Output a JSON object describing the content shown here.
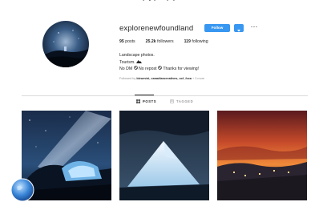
{
  "profile": {
    "username": "explorenewfoundland",
    "follow_label": "Follow",
    "more_label": "···"
  },
  "stats": {
    "posts_count": "95",
    "posts_label": "posts",
    "followers_count": "25.2k",
    "followers_label": "followers",
    "following_count": "119",
    "following_label": "following"
  },
  "bio": {
    "line1": "Landscape photos.",
    "line2_text": "Tourism. ",
    "line3_no_dm": "No DM",
    "line3_no_repost": "No repost",
    "line3_thanks": "Thanks for viewing!"
  },
  "followed_by": {
    "prefix": "Followed by ",
    "names": "bleuevizi, canadiancreatives, ocf_fcca",
    "suffix": " + 3 more"
  },
  "tabs": [
    {
      "label": "POSTS",
      "active": true
    },
    {
      "label": "TAGGED",
      "active": false
    }
  ],
  "colors": {
    "accent": "#3897f0",
    "muted": "#8e8e8e"
  },
  "icons": [
    "grid-icon",
    "tag-icon",
    "more-icon",
    "chevron-down-icon",
    "no-entry-icon",
    "mountain-icon",
    "globe-icon"
  ]
}
